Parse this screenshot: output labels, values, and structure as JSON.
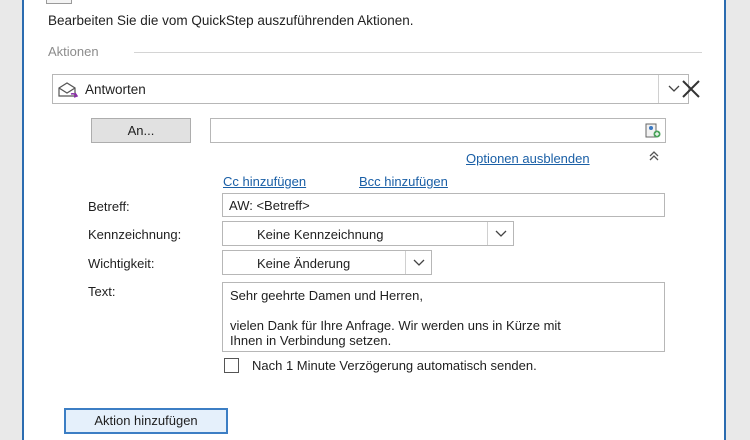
{
  "instruction": "Bearbeiten Sie die vom QuickStep auszuführenden Aktionen.",
  "section": {
    "label": "Aktionen"
  },
  "action": {
    "selected": "Antworten",
    "icon": "reply-envelope-icon",
    "remove_icon": "close-icon"
  },
  "recipient": {
    "button_label": "An...",
    "value": "",
    "address_book_icon": "address-book-icon"
  },
  "options": {
    "hide_label": "Optionen ausblenden",
    "collapse_icon": "double-chevron-up-icon",
    "add_cc": "Cc hinzufügen",
    "add_bcc": "Bcc hinzufügen"
  },
  "fields": {
    "betreff_label": "Betreff:",
    "betreff_value": "AW: <Betreff>",
    "kennzeichnung_label": "Kennzeichnung:",
    "kennzeichnung_value": "Keine Kennzeichnung",
    "wichtigkeit_label": "Wichtigkeit:",
    "wichtigkeit_value": "Keine Änderung",
    "text_label": "Text:",
    "text_line1": "Sehr geehrte Damen und Herren,",
    "text_line2": "vielen Dank für Ihre Anfrage. Wir werden uns in Kürze mit",
    "text_line3": "Ihnen in Verbindung setzen."
  },
  "delay": {
    "checked": false,
    "label": "Nach 1 Minute Verzögerung automatisch senden."
  },
  "add_action_label": "Aktion hinzufügen"
}
